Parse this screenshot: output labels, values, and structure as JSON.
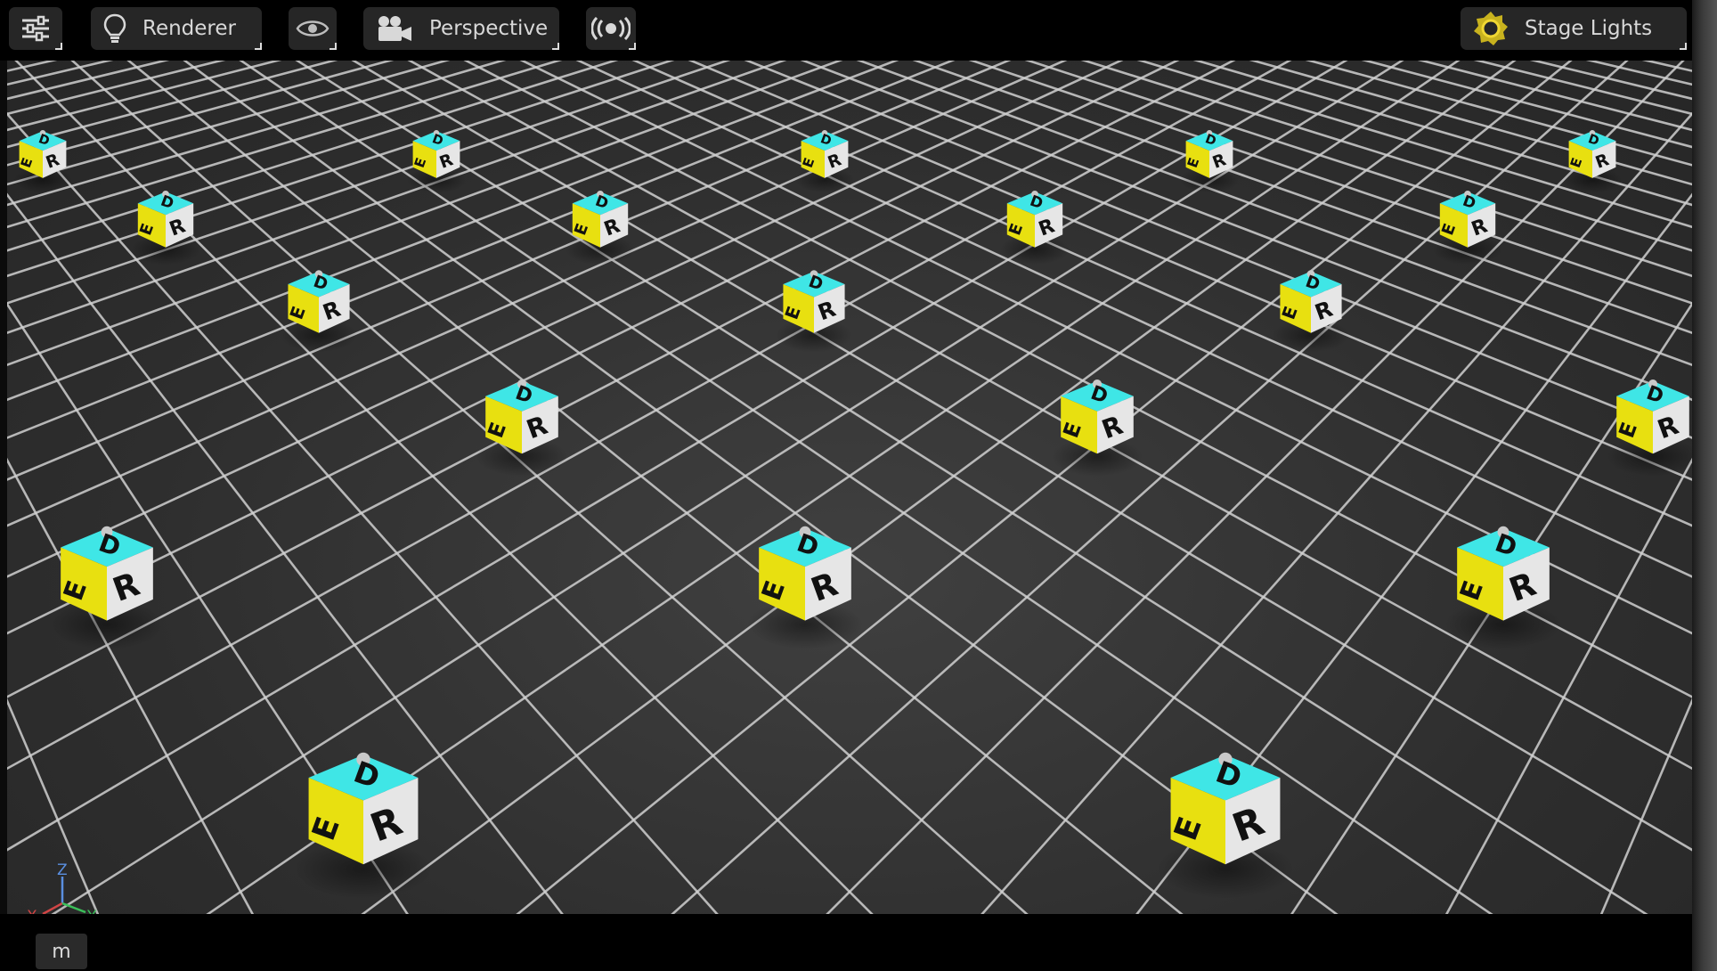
{
  "toolbar": {
    "settings_icon": "sliders-icon",
    "renderer": {
      "icon": "lightbulb-icon",
      "label": "Renderer"
    },
    "visibility_icon": "eye-icon",
    "camera": {
      "icon": "movie-camera-icon",
      "label": "Perspective"
    },
    "broadcast_icon": "broadcast-icon",
    "stage_lights": {
      "icon": "sun-icon",
      "label": "Stage Lights"
    }
  },
  "viewport": {
    "cube_faces": {
      "top": "D",
      "left": "E",
      "right": "R"
    },
    "colors": {
      "cyan": "#3fe6e6",
      "yellow": "#e8e010",
      "white": "#e6e6e6",
      "grid": "#d0d0d0"
    }
  },
  "axis_gizmo": {
    "z": "Z",
    "x": "X",
    "y": "Y"
  },
  "status": {
    "unit": "m"
  }
}
